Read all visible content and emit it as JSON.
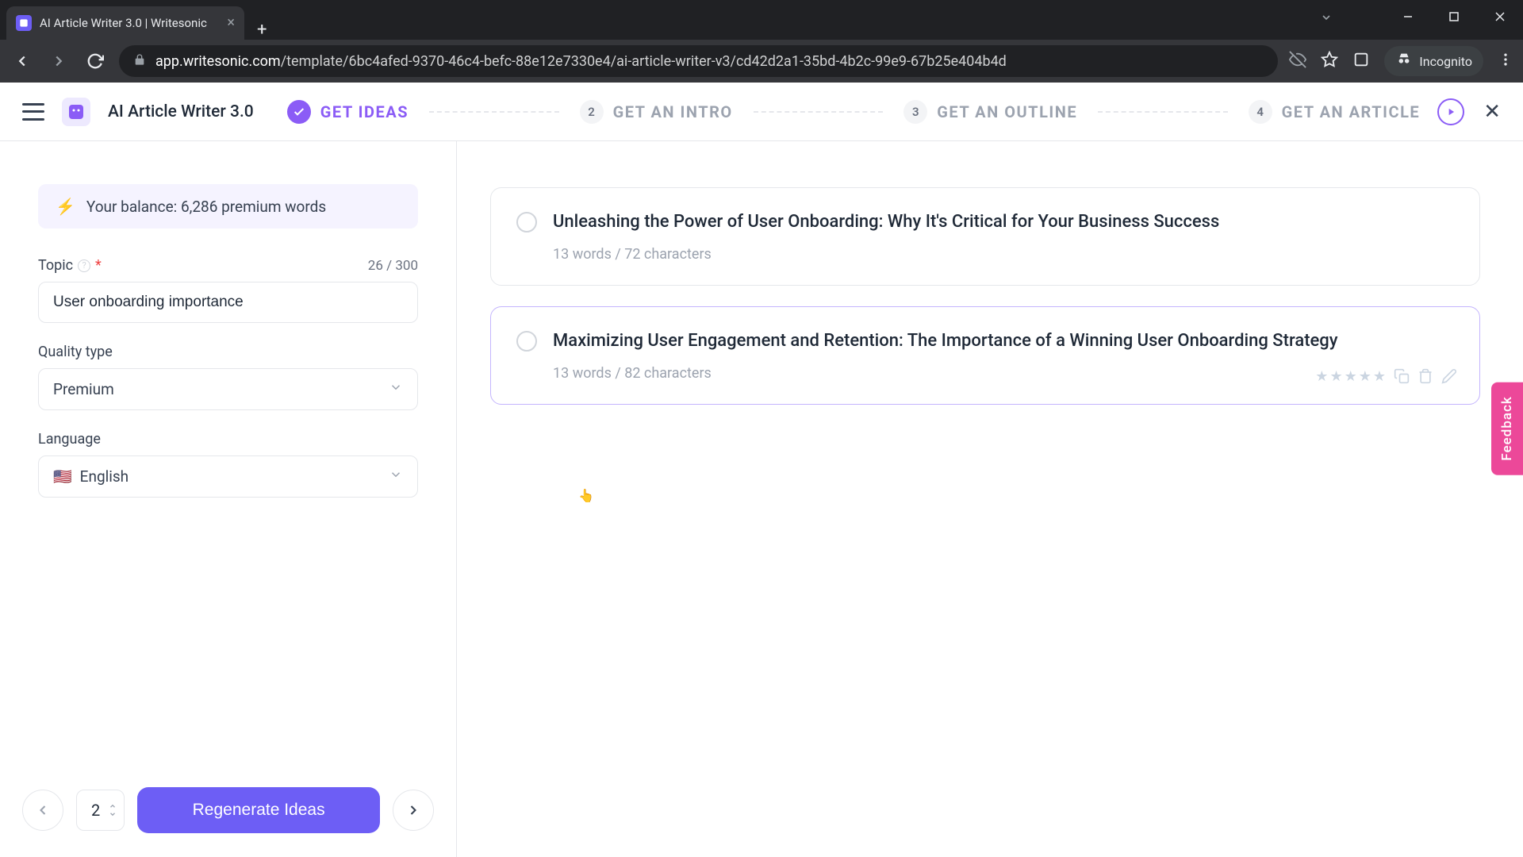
{
  "browser": {
    "tab_title": "AI Article Writer 3.0 | Writesonic",
    "url_domain": "app.writesonic.com",
    "url_path": "/template/6bc4afed-9370-46c4-befc-88e12e7330e4/ai-article-writer-v3/cd42d2a1-35bd-4b2c-99e9-67b25e404b4d",
    "incognito_label": "Incognito"
  },
  "header": {
    "app_title": "AI Article Writer 3.0",
    "steps": {
      "s1": "GET IDEAS",
      "s2": "GET AN INTRO",
      "s2_num": "2",
      "s3": "GET AN OUTLINE",
      "s3_num": "3",
      "s4": "GET AN ARTICLE",
      "s4_num": "4"
    }
  },
  "sidebar": {
    "balance_text": "Your balance: 6,286 premium words",
    "topic_label": "Topic",
    "topic_count": "26 / 300",
    "topic_value": "User onboarding importance",
    "quality_label": "Quality type",
    "quality_value": "Premium",
    "language_label": "Language",
    "language_value": "English",
    "footer": {
      "count": "2",
      "regen_label": "Regenerate Ideas"
    }
  },
  "ideas": [
    {
      "title": "Unleashing the Power of User Onboarding: Why It's Critical for Your Business Success",
      "meta": "13 words / 72 characters"
    },
    {
      "title": "Maximizing User Engagement and Retention: The Importance of a Winning User Onboarding Strategy",
      "meta": "13 words / 82 characters"
    }
  ],
  "feedback_label": "Feedback"
}
